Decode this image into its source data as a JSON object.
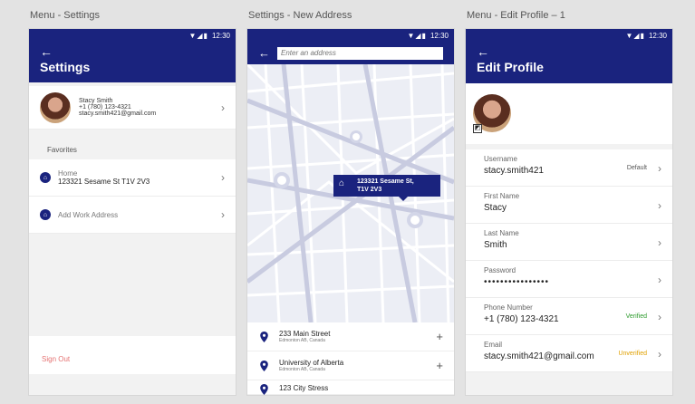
{
  "labels": {
    "screen1": "Menu - Settings",
    "screen2": "Settings - New Address",
    "screen3": "Menu - Edit Profile – 1"
  },
  "status": {
    "time": "12:30"
  },
  "settings": {
    "title": "Settings",
    "user": {
      "name": "Stacy Smith",
      "phone": "+1 (780)  123-4321",
      "email": "stacy.smith421@gmail.com"
    },
    "favorites_label": "Favorites",
    "home_label": "Home",
    "home_address": "123321 Sesame St T1V 2V3",
    "add_work": "Add Work Address",
    "sign_out": "Sign Out"
  },
  "new_address": {
    "search_placeholder": "Enter an address",
    "pin_line1": "123321 Sesame St,",
    "pin_line2": "T1V 2V3",
    "results": [
      {
        "name": "233 Main Street",
        "sub": "Edmonton AB, Canada"
      },
      {
        "name": "University of Alberta",
        "sub": "Edmonton AB, Canada"
      },
      {
        "name": "123 City Stress",
        "sub": ""
      }
    ]
  },
  "edit_profile": {
    "title": "Edit Profile",
    "fields": [
      {
        "label": "Username",
        "value": "stacy.smith421",
        "tag": "Default"
      },
      {
        "label": "First Name",
        "value": "Stacy",
        "tag": ""
      },
      {
        "label": "Last Name",
        "value": "Smith",
        "tag": ""
      },
      {
        "label": "Password",
        "value": "••••••••••••••••",
        "tag": ""
      },
      {
        "label": "Phone Number",
        "value": "+1 (780) 123-4321",
        "tag": "Verified"
      },
      {
        "label": "Email",
        "value": "stacy.smith421@gmail.com",
        "tag": "Unverified"
      }
    ]
  },
  "colors": {
    "primary": "#1a237e",
    "verified": "#2e9b2e",
    "unverified": "#e0a000",
    "sign_out": "#e57373"
  },
  "icons": [
    "back-arrow-icon",
    "wifi-icon",
    "signal-icon",
    "battery-icon",
    "home-icon",
    "chevron-right-icon",
    "location-pin-icon",
    "plus-icon",
    "edit-icon"
  ]
}
